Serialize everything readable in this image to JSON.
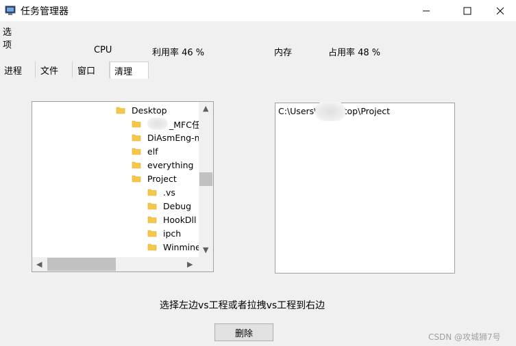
{
  "window": {
    "title": "任务管理器"
  },
  "menu": {
    "options": "选项"
  },
  "stats": {
    "cpu_label": "CPU",
    "cpu_usage": "利用率 46 %",
    "memory_label": "内存",
    "memory_usage": "占用率 48 %"
  },
  "tabs": [
    {
      "label": "进程"
    },
    {
      "label": "文件"
    },
    {
      "label": "窗口"
    },
    {
      "label": "清理",
      "active": true
    }
  ],
  "tree": {
    "items": [
      {
        "label": "Desktop",
        "level": 0
      },
      {
        "label": "_MFC任",
        "level": 1
      },
      {
        "label": "DiAsmEng-ma",
        "level": 1
      },
      {
        "label": "elf",
        "level": 1
      },
      {
        "label": "everything",
        "level": 1
      },
      {
        "label": "Project",
        "level": 1
      },
      {
        "label": ".vs",
        "level": 2
      },
      {
        "label": "Debug",
        "level": 2
      },
      {
        "label": "HookDll",
        "level": 2
      },
      {
        "label": "ipch",
        "level": 2
      },
      {
        "label": "Winmine",
        "level": 2
      }
    ]
  },
  "path_panel": {
    "path": "C:\\Users\\        \\Desktop\\Project"
  },
  "instruction": "选择左边vs工程或者拉拽vs工程到右边",
  "buttons": {
    "delete": "删除"
  },
  "watermark": "CSDN @攻城狮7号",
  "colors": {
    "folder": "#f5c84c",
    "folder_dark": "#e3a92b",
    "window_bg": "#f0f0f0"
  }
}
